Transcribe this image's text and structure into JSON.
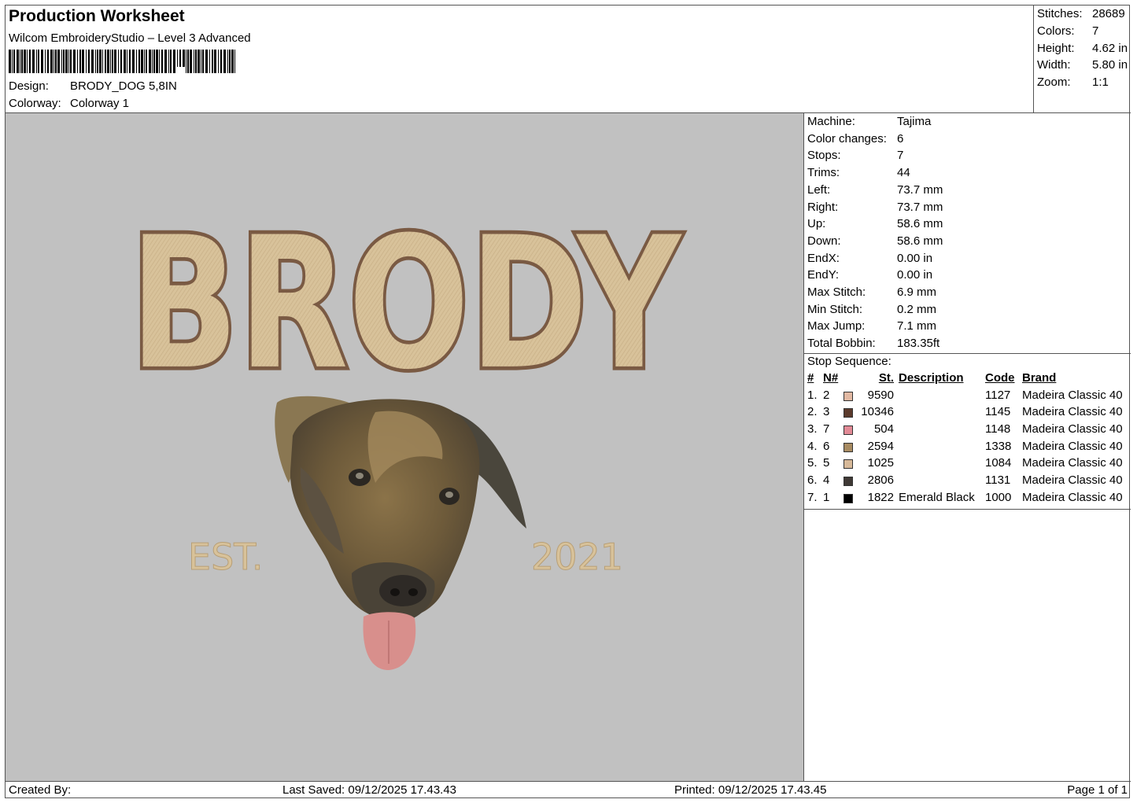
{
  "header": {
    "title": "Production Worksheet",
    "software": "Wilcom EmbroideryStudio – Level 3 Advanced",
    "design_label": "Design:",
    "design_value": "BRODY_DOG 5,8IN",
    "colorway_label": "Colorway:",
    "colorway_value": "Colorway 1"
  },
  "summary": [
    {
      "label": "Stitches:",
      "value": "28689"
    },
    {
      "label": "Colors:",
      "value": "7"
    },
    {
      "label": "Height:",
      "value": "4.62 in"
    },
    {
      "label": "Width:",
      "value": "5.80 in"
    },
    {
      "label": "Zoom:",
      "value": "1:1"
    }
  ],
  "design_preview": {
    "name_text": "BRODY",
    "left_text": "EST.",
    "right_text": "2021",
    "colors": {
      "background": "#c1c1c1",
      "fill": "#d8c29a",
      "outline": "#7a5a43",
      "tongue": "#d88f8c"
    }
  },
  "machine_info": [
    {
      "label": "Machine:",
      "value": "Tajima"
    },
    {
      "label": "Color changes:",
      "value": "6"
    },
    {
      "label": "Stops:",
      "value": "7"
    },
    {
      "label": "Trims:",
      "value": "44"
    },
    {
      "label": "Left:",
      "value": "73.7 mm"
    },
    {
      "label": "Right:",
      "value": "73.7 mm"
    },
    {
      "label": "Up:",
      "value": "58.6 mm"
    },
    {
      "label": "Down:",
      "value": "58.6 mm"
    },
    {
      "label": "EndX:",
      "value": "0.00 in"
    },
    {
      "label": "EndY:",
      "value": "0.00 in"
    },
    {
      "label": "Max Stitch:",
      "value": "6.9 mm"
    },
    {
      "label": "Min Stitch:",
      "value": "0.2 mm"
    },
    {
      "label": "Max Jump:",
      "value": "7.1 mm"
    },
    {
      "label": "Total Bobbin:",
      "value": "183.35ft"
    }
  ],
  "stop_sequence": {
    "title": "Stop Sequence:",
    "headers": {
      "idx": "#",
      "n": "N#",
      "st": "St.",
      "desc": "Description",
      "code": "Code",
      "brand": "Brand"
    },
    "rows": [
      {
        "idx": "1.",
        "n": "2",
        "color": "#e2b9a3",
        "st": "9590",
        "desc": "",
        "code": "1127",
        "brand": "Madeira Classic 40"
      },
      {
        "idx": "2.",
        "n": "3",
        "color": "#5b3a2c",
        "st": "10346",
        "desc": "",
        "code": "1145",
        "brand": "Madeira Classic 40"
      },
      {
        "idx": "3.",
        "n": "7",
        "color": "#e28a96",
        "st": "504",
        "desc": "",
        "code": "1148",
        "brand": "Madeira Classic 40"
      },
      {
        "idx": "4.",
        "n": "6",
        "color": "#a88b62",
        "st": "2594",
        "desc": "",
        "code": "1338",
        "brand": "Madeira Classic 40"
      },
      {
        "idx": "5.",
        "n": "5",
        "color": "#d7b999",
        "st": "1025",
        "desc": "",
        "code": "1084",
        "brand": "Madeira Classic 40"
      },
      {
        "idx": "6.",
        "n": "4",
        "color": "#3f3935",
        "st": "2806",
        "desc": "",
        "code": "1131",
        "brand": "Madeira Classic 40"
      },
      {
        "idx": "7.",
        "n": "1",
        "color": "#000000",
        "st": "1822",
        "desc": "Emerald Black",
        "code": "1000",
        "brand": "Madeira Classic 40"
      }
    ]
  },
  "footer": {
    "created_by": "Created By:",
    "last_saved": "Last Saved: 09/12/2025 17.43.43",
    "printed": "Printed: 09/12/2025 17.43.45",
    "page": "Page 1 of 1"
  }
}
